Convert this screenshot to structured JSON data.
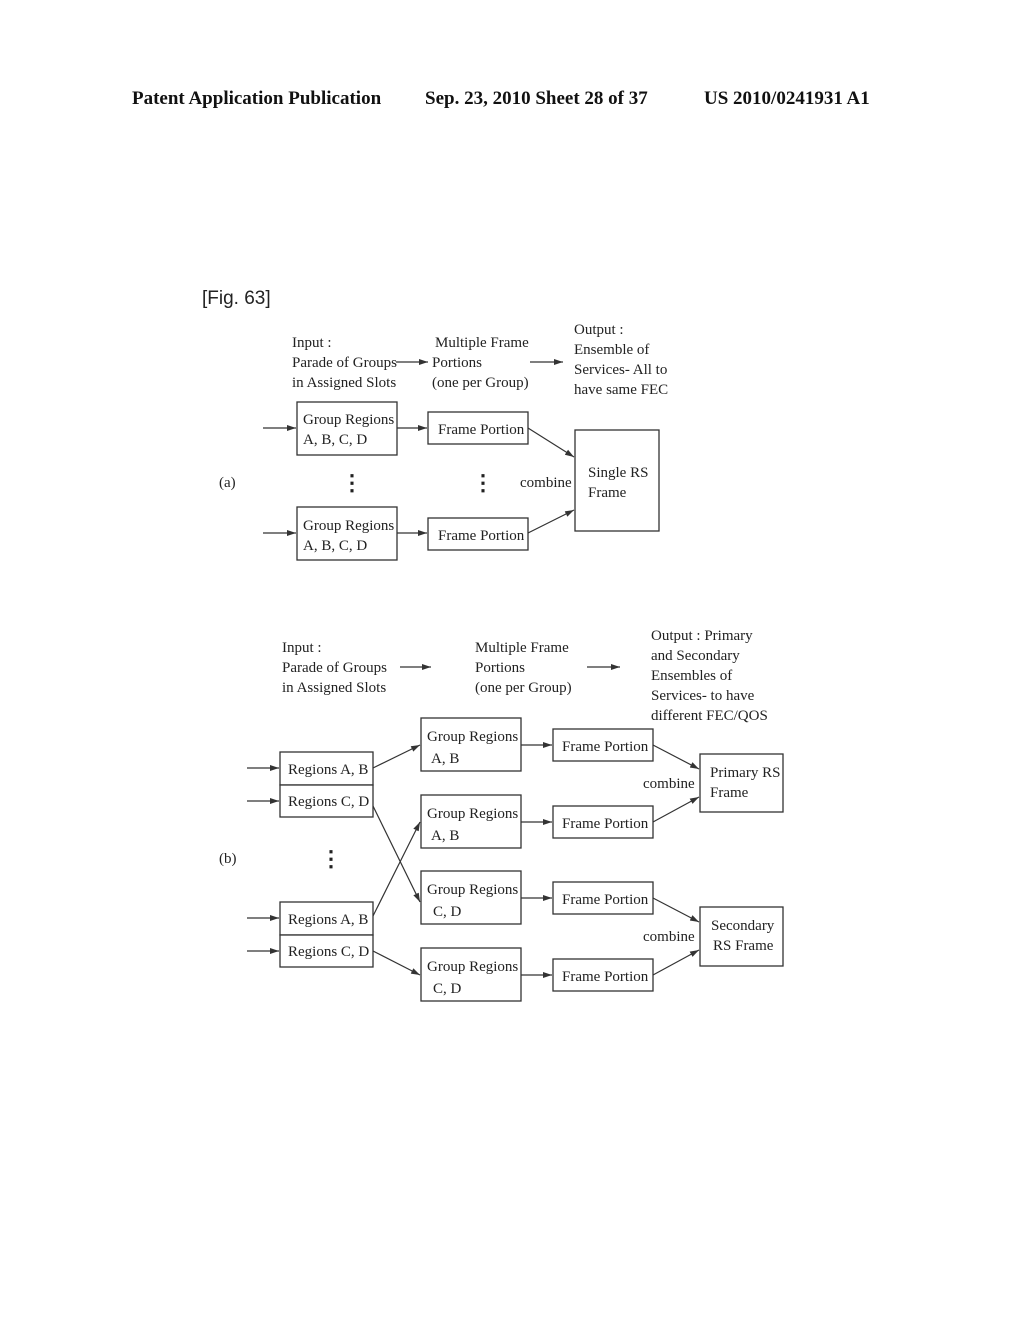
{
  "header": {
    "publication": "Patent Application Publication",
    "date_sheet": "Sep. 23, 2010   Sheet 28 of 37",
    "number": "US 2010/0241931 A1"
  },
  "figure": {
    "label": "[Fig. 63]",
    "part_a": {
      "label": "(a)",
      "input": [
        "Input :",
        "Parade of Groups",
        "in Assigned Slots"
      ],
      "middle": [
        "Multiple Frame",
        "Portions",
        "(one per Group)"
      ],
      "output": [
        "Output :",
        "Ensemble of",
        "Services- All to",
        "have same FEC"
      ],
      "group_box": [
        "Group Regions",
        "A, B, C, D"
      ],
      "frame_portion": "Frame Portion",
      "combine": "combine",
      "result": [
        "Single RS",
        "Frame"
      ],
      "ellipsis": "⋮"
    },
    "part_b": {
      "label": "(b)",
      "input": [
        "Input :",
        "Parade of Groups",
        "in Assigned Slots"
      ],
      "middle": [
        "Multiple Frame",
        "Portions",
        "(one per Group)"
      ],
      "output": [
        "Output : Primary",
        "and Secondary",
        "Ensembles of",
        "Services- to have",
        "different FEC/QOS"
      ],
      "regions_ab": "Regions A, B",
      "regions_cd": "Regions C, D",
      "group_ab": [
        "Group Regions",
        "A, B"
      ],
      "group_cd": [
        "Group Regions",
        "C, D"
      ],
      "frame_portion": "Frame Portion",
      "combine": "combine",
      "primary": [
        "Primary RS",
        "Frame"
      ],
      "secondary": [
        "Secondary",
        "RS Frame"
      ],
      "ellipsis": "⋮"
    }
  }
}
